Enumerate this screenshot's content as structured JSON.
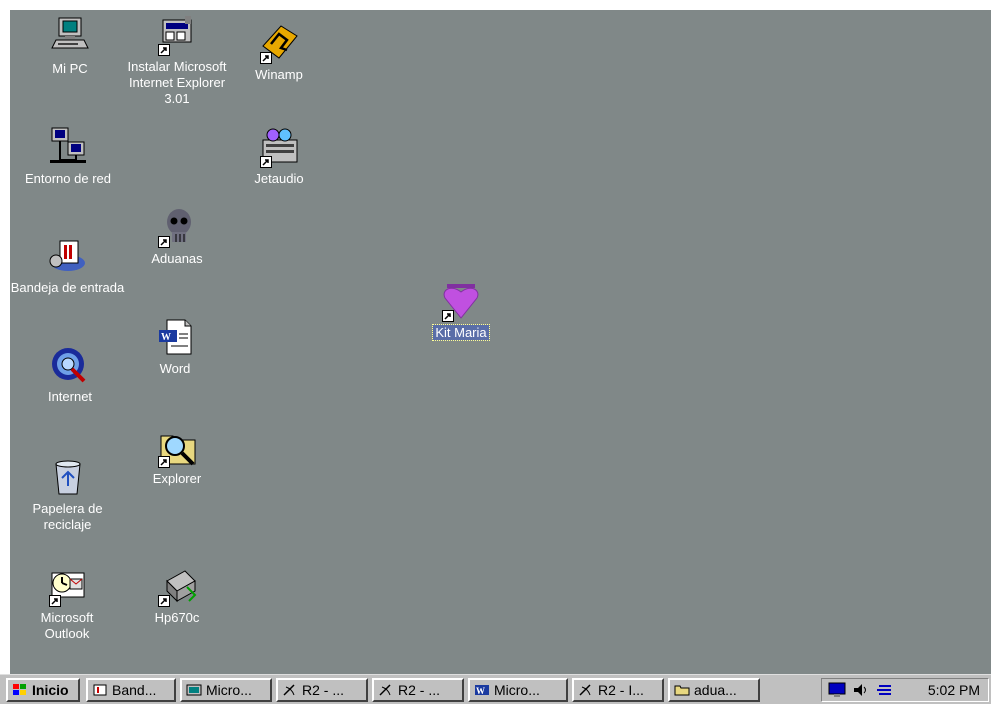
{
  "desktop": {
    "background": "#808888",
    "icons": [
      {
        "id": "mi-pc",
        "label": "Mi PC"
      },
      {
        "id": "entorno",
        "label": "Entorno de red"
      },
      {
        "id": "bandeja",
        "label": "Bandeja de entrada"
      },
      {
        "id": "internet",
        "label": "Internet"
      },
      {
        "id": "papelera",
        "label": "Papelera de reciclaje"
      },
      {
        "id": "outlook",
        "label": "Microsoft Outlook"
      },
      {
        "id": "instalar",
        "label": "Instalar Microsoft Internet Explorer 3.01"
      },
      {
        "id": "aduanas",
        "label": "Aduanas"
      },
      {
        "id": "word",
        "label": "Word"
      },
      {
        "id": "explorer",
        "label": "Explorer"
      },
      {
        "id": "hp670c",
        "label": "Hp670c"
      },
      {
        "id": "winamp",
        "label": "Winamp"
      },
      {
        "id": "jetaudio",
        "label": "Jetaudio"
      },
      {
        "id": "kit-maria",
        "label": "Kit Maria",
        "selected": true
      }
    ]
  },
  "taskbar": {
    "start_label": "Inicio",
    "buttons": [
      {
        "label": "Band...",
        "icon": "inbox-icon"
      },
      {
        "label": "Micro...",
        "icon": "window-icon"
      },
      {
        "label": "R2 - ...",
        "icon": "satellite-icon"
      },
      {
        "label": "R2 - ...",
        "icon": "satellite-icon"
      },
      {
        "label": "Micro...",
        "icon": "word-icon"
      },
      {
        "label": "R2 - I...",
        "icon": "satellite-icon"
      },
      {
        "label": "adua...",
        "icon": "folder-icon"
      }
    ],
    "clock": "5:02 PM"
  }
}
